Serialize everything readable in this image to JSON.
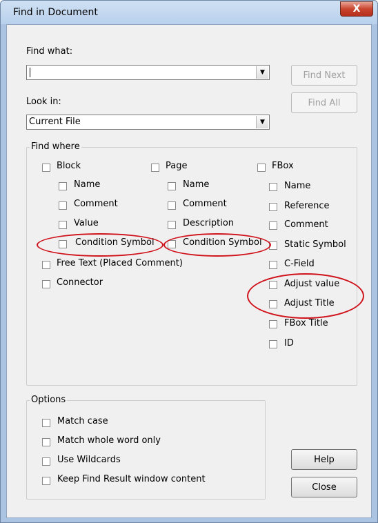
{
  "window": {
    "title": "Find in Document",
    "close_glyph": "X"
  },
  "find_what": {
    "label": "Find what:",
    "value": ""
  },
  "look_in": {
    "label": "Look in:",
    "value": "Current File"
  },
  "buttons": {
    "find_next": "Find Next",
    "find_all": "Find All",
    "help": "Help",
    "close": "Close"
  },
  "find_where": {
    "title": "Find where",
    "block": {
      "label": "Block",
      "items": [
        "Name",
        "Comment",
        "Value",
        "Condition Symbol"
      ]
    },
    "page": {
      "label": "Page",
      "items": [
        "Name",
        "Comment",
        "Description",
        "Condition Symbol"
      ]
    },
    "fbox": {
      "label": "FBox",
      "items": [
        "Name",
        "Reference",
        "Comment",
        "Static Symbol",
        "C-Field",
        "Adjust value",
        "Adjust Title",
        "FBox Title",
        "ID"
      ]
    },
    "free_text": "Free Text (Placed Comment)",
    "connector": "Connector"
  },
  "options": {
    "title": "Options",
    "items": [
      "Match case",
      "Match whole word only",
      "Use Wildcards",
      "Keep Find Result window content"
    ]
  },
  "annotation_color": "#d0121b"
}
